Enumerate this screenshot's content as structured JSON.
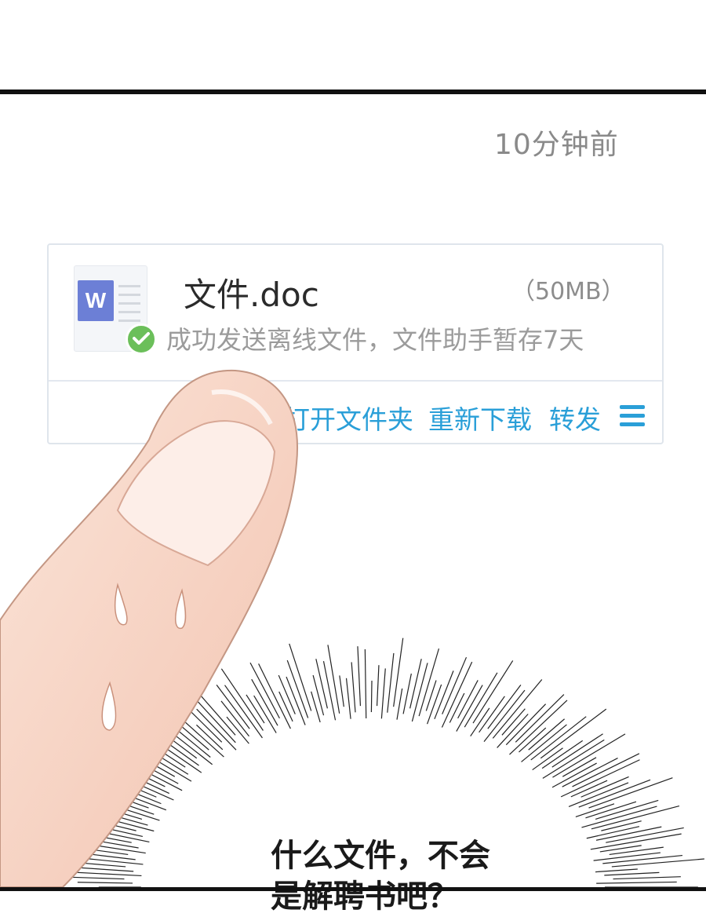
{
  "timestamp": "10分钟前",
  "file": {
    "name": "文件.doc",
    "size": "（50MB）",
    "status": "成功发送离线文件，文件助手暂存7天",
    "icon": "word-document-icon",
    "status_icon": "success-check-icon"
  },
  "actions": {
    "open_folder": "打开文件夹",
    "redownload": "重新下载",
    "forward": "转发",
    "menu_icon": "hamburger-menu-icon"
  },
  "speech": {
    "line1": "什么文件，不会",
    "line2": "是解聘书吧？"
  },
  "colors": {
    "accent": "#2a9fd8",
    "word_blue": "#6c7fd6",
    "check_green": "#6bbf5a",
    "skin": "#f6d3c2"
  }
}
